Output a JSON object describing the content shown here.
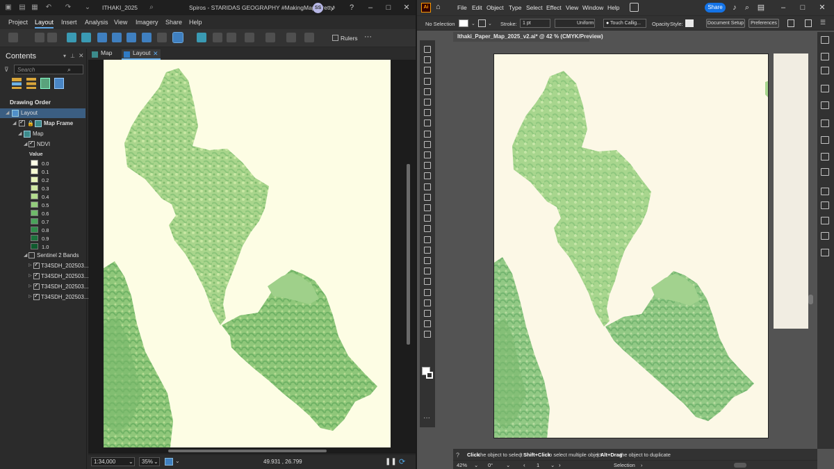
{
  "pro": {
    "project": "ITHAKI_2025",
    "window_title": "Spiros - STARIDAS GEOGRAPHY #MakingMapsPretty",
    "avatar": "SS",
    "menu": [
      "Project",
      "Layout",
      "Insert",
      "Analysis",
      "View",
      "Imagery",
      "Share",
      "Help"
    ],
    "active_menu": "Layout",
    "ribbon_rulers": "Rulers",
    "contents": {
      "title": "Contents",
      "search_placeholder": "Search",
      "drawing_order": "Drawing Order",
      "layout": "Layout",
      "map_frame": "Map Frame",
      "map": "Map",
      "ndvi": "NDVI",
      "value_label": "Value",
      "legend": [
        {
          "label": "0.0",
          "color": "#fefee6"
        },
        {
          "label": "0.1",
          "color": "#f6fbd2"
        },
        {
          "label": "0.2",
          "color": "#e6f3b8"
        },
        {
          "label": "0.3",
          "color": "#cfe8a2"
        },
        {
          "label": "0.4",
          "color": "#b3db8e"
        },
        {
          "label": "0.5",
          "color": "#93cc7c"
        },
        {
          "label": "0.6",
          "color": "#6fb96a"
        },
        {
          "label": "0.7",
          "color": "#4aa35a"
        },
        {
          "label": "0.8",
          "color": "#2f8c4a"
        },
        {
          "label": "0.9",
          "color": "#1c733c"
        },
        {
          "label": "1.0",
          "color": "#0f5a2e"
        }
      ],
      "sentinel_group": "Sentinel 2 Bands",
      "bands": [
        "T34SDH_202503...",
        "T34SDH_202503...",
        "T34SDH_202503...",
        "T34SDH_202503..."
      ]
    },
    "tabs": [
      {
        "label": "Map"
      },
      {
        "label": "Layout"
      }
    ],
    "status": {
      "scale": "1:34,000",
      "zoom": "35%",
      "coords": "49.931 , 26.799"
    }
  },
  "ai": {
    "logo": "Ai",
    "menu": [
      "File",
      "Edit",
      "Object",
      "Type",
      "Select",
      "Effect",
      "View",
      "Window",
      "Help"
    ],
    "share": "Share",
    "control": {
      "no_selection": "No Selection",
      "stroke_label": "Stroke:",
      "stroke_value": "1 pt",
      "uniform": "Uniform",
      "brush": "Touch Callig...",
      "opacity": "Opacity",
      "style": "Style:",
      "document_setup": "Document Setup",
      "preferences": "Preferences"
    },
    "doc_tab": "Ithaki_Paper_Map_2025_v2.ai* @ 42 % (CMYK/Preview)",
    "hint": {
      "click": "Click",
      "click_text": "the object to select",
      "shift": "Shift+Click",
      "shift_text": "to select multiple object",
      "alt": "Alt+Drag",
      "alt_text": "the object to duplicate"
    },
    "status": {
      "zoom": "42%",
      "rotation": "0°",
      "artboard": "1",
      "tool": "Selection"
    }
  }
}
